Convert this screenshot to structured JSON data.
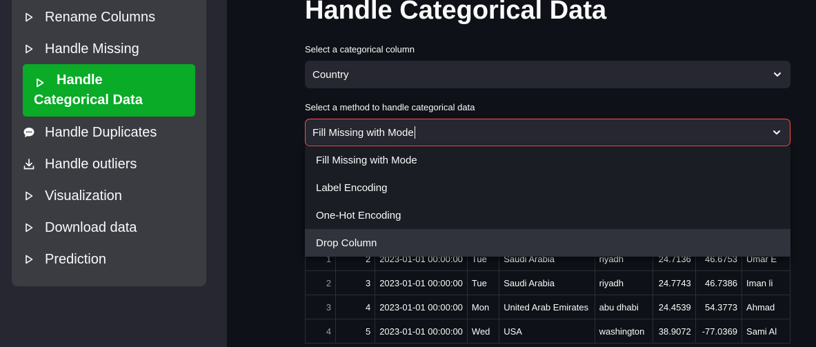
{
  "sidebar": {
    "items": [
      {
        "label": "Rename Columns",
        "icon": "play-icon"
      },
      {
        "label": "Handle Missing",
        "icon": "play-icon"
      },
      {
        "label": "Handle Categorical Data",
        "icon": "play-icon",
        "active": true
      },
      {
        "label": "Handle Duplicates",
        "icon": "chat-bubble-icon"
      },
      {
        "label": "Handle outliers",
        "icon": "download-icon"
      },
      {
        "label": "Visualization",
        "icon": "play-icon"
      },
      {
        "label": "Download data",
        "icon": "play-icon"
      },
      {
        "label": "Prediction",
        "icon": "play-icon"
      }
    ],
    "active_line1": "Handle",
    "active_line2": "Categorical Data",
    "active_color": "#09ab27"
  },
  "main": {
    "title": "Handle Categorical Data",
    "column_select": {
      "label": "Select a categorical column",
      "value": "Country"
    },
    "method_select": {
      "label": "Select a method to handle categorical data",
      "value": "Fill Missing with Mode",
      "options": [
        "Fill Missing with Mode",
        "Label Encoding",
        "One-Hot Encoding",
        "Drop Column"
      ]
    },
    "table": {
      "rows": [
        [
          "1",
          "2",
          "2023-01-01 00:00:00",
          "Tue",
          "Saudi Arabia",
          "riyadh",
          "24.7136",
          "46.6753",
          "Umar E"
        ],
        [
          "2",
          "3",
          "2023-01-01 00:00:00",
          "Tue",
          "Saudi Arabia",
          "riyadh",
          "24.7743",
          "46.7386",
          "Iman li"
        ],
        [
          "3",
          "4",
          "2023-01-01 00:00:00",
          "Mon",
          "United Arab Emirates",
          "abu dhabi",
          "24.4539",
          "54.3773",
          "Ahmad"
        ],
        [
          "4",
          "5",
          "2023-01-01 00:00:00",
          "Wed",
          "USA",
          "washington",
          "38.9072",
          "-77.0369",
          "Sami Al"
        ]
      ]
    }
  },
  "colors": {
    "accent": "#ff4b4b",
    "sidebar": "#262730",
    "background": "#0e1117"
  }
}
